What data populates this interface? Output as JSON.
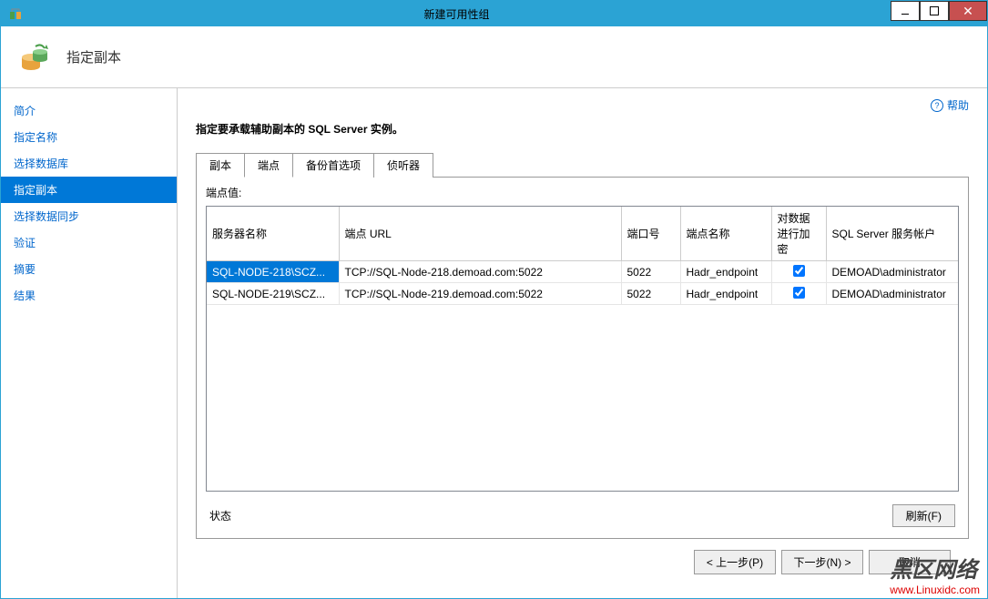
{
  "window": {
    "title": "新建可用性组"
  },
  "header": {
    "title": "指定副本"
  },
  "help": {
    "label": "帮助"
  },
  "sidebar": {
    "items": [
      {
        "label": "简介"
      },
      {
        "label": "指定名称"
      },
      {
        "label": "选择数据库"
      },
      {
        "label": "指定副本"
      },
      {
        "label": "选择数据同步"
      },
      {
        "label": "验证"
      },
      {
        "label": "摘要"
      },
      {
        "label": "结果"
      }
    ],
    "active_index": 3
  },
  "main": {
    "instruction": "指定要承载辅助副本的 SQL Server 实例。",
    "tabs": [
      {
        "label": "副本"
      },
      {
        "label": "端点"
      },
      {
        "label": "备份首选项"
      },
      {
        "label": "侦听器"
      }
    ],
    "active_tab_index": 1,
    "section_label": "端点值:",
    "columns": [
      "服务器名称",
      "端点 URL",
      "端口号",
      "端点名称",
      "对数据进行加密",
      "SQL Server 服务帐户"
    ],
    "rows": [
      {
        "server": "SQL-NODE-218\\SCZ...",
        "url": "TCP://SQL-Node-218.demoad.com:5022",
        "port": "5022",
        "endpoint_name": "Hadr_endpoint",
        "encrypted": true,
        "account": "DEMOAD\\administrator"
      },
      {
        "server": "SQL-NODE-219\\SCZ...",
        "url": "TCP://SQL-Node-219.demoad.com:5022",
        "port": "5022",
        "endpoint_name": "Hadr_endpoint",
        "encrypted": true,
        "account": "DEMOAD\\administrator"
      }
    ],
    "selected_row_index": 0,
    "status_label": "状态",
    "refresh_label": "刷新(F)"
  },
  "footer": {
    "prev": "< 上一步(P)",
    "next": "下一步(N) >",
    "cancel": "取消"
  },
  "watermark": {
    "text": "黑区网络",
    "url": "www.Linuxidc.com"
  }
}
